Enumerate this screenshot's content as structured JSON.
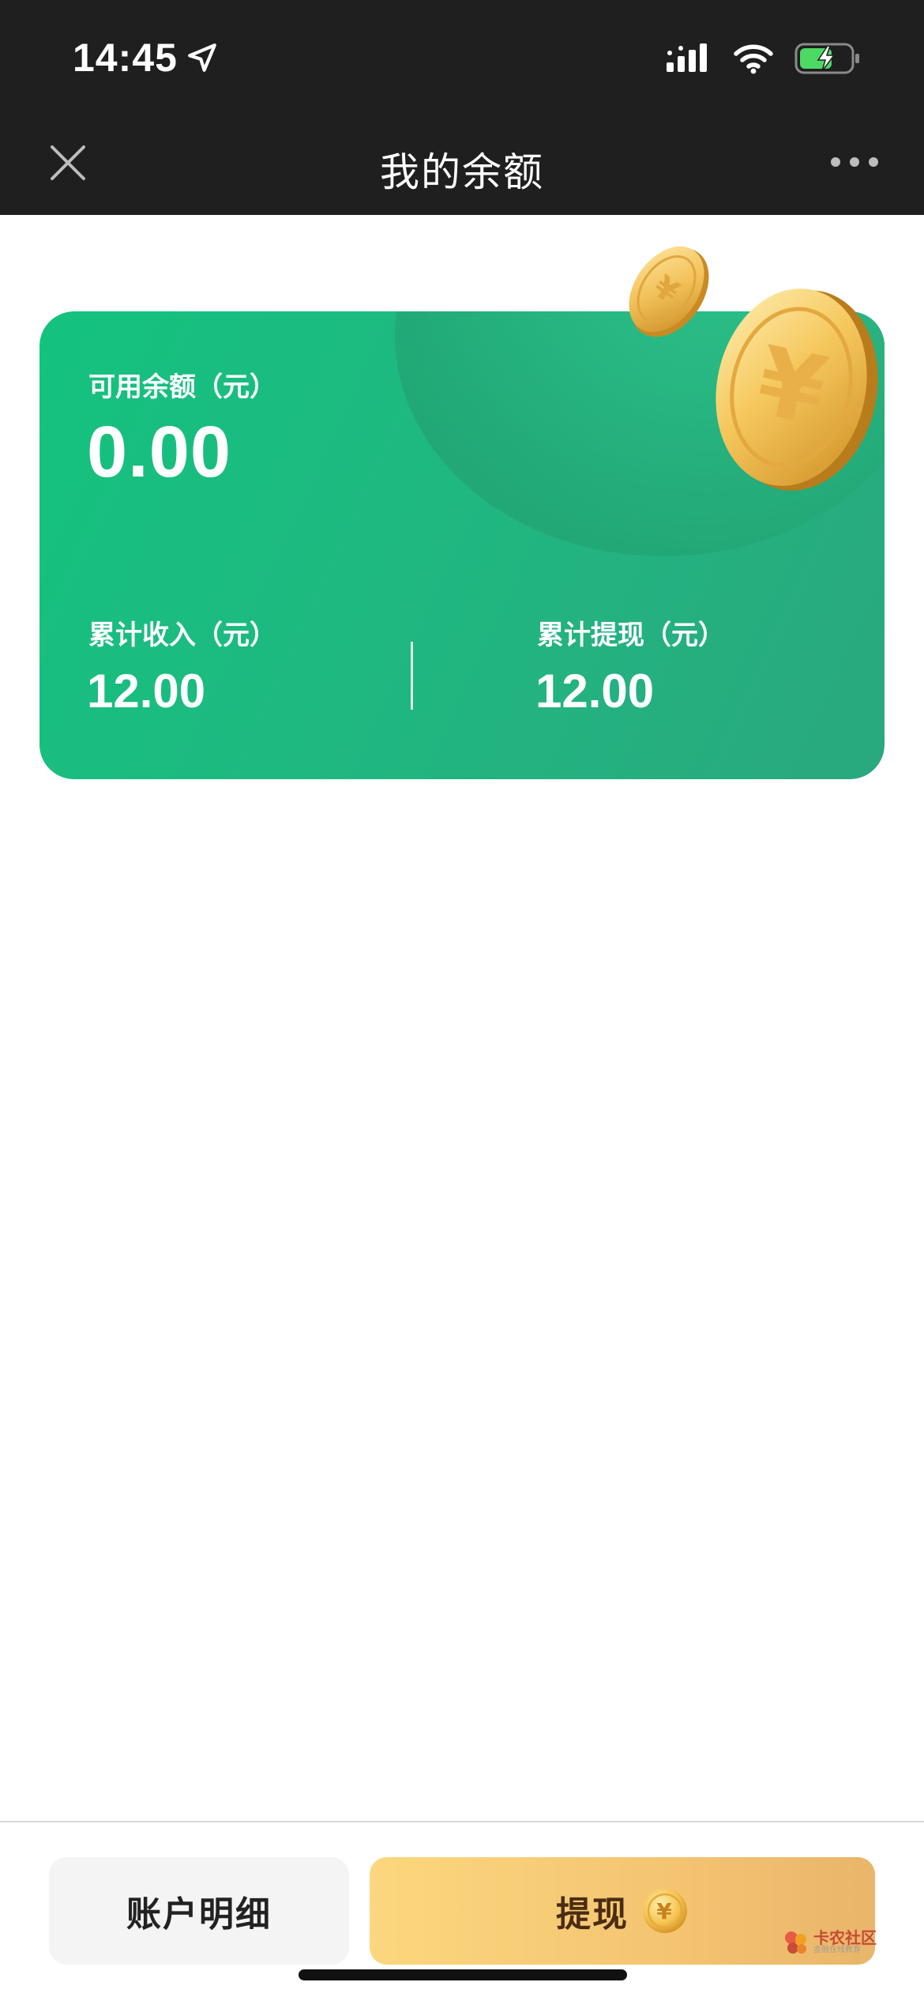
{
  "status_bar": {
    "time": "14:45",
    "icons": [
      "location-arrow-icon",
      "cellular-signal-icon",
      "wifi-icon",
      "battery-charging-icon"
    ]
  },
  "nav": {
    "title": "我的余额",
    "close_icon": "close-icon",
    "more_icon": "more-icon"
  },
  "card": {
    "available_label": "可用余额（元）",
    "available_value": "0.00",
    "income_label": "累计收入（元）",
    "income_value": "12.00",
    "withdrawn_label": "累计提现（元）",
    "withdrawn_value": "12.00",
    "colors": {
      "gradient_start": "#14c27e",
      "gradient_end": "#2aa87e",
      "coin": "#f2c15a"
    }
  },
  "bottom": {
    "detail_label": "账户明细",
    "withdraw_label": "提现",
    "withdraw_icon": "yen-coin-icon",
    "colors": {
      "withdraw_bg": "#f7c978",
      "detail_bg": "#f4f4f4"
    }
  },
  "watermark": {
    "title": "卡农社区",
    "subtitle": "金融在线教育"
  }
}
